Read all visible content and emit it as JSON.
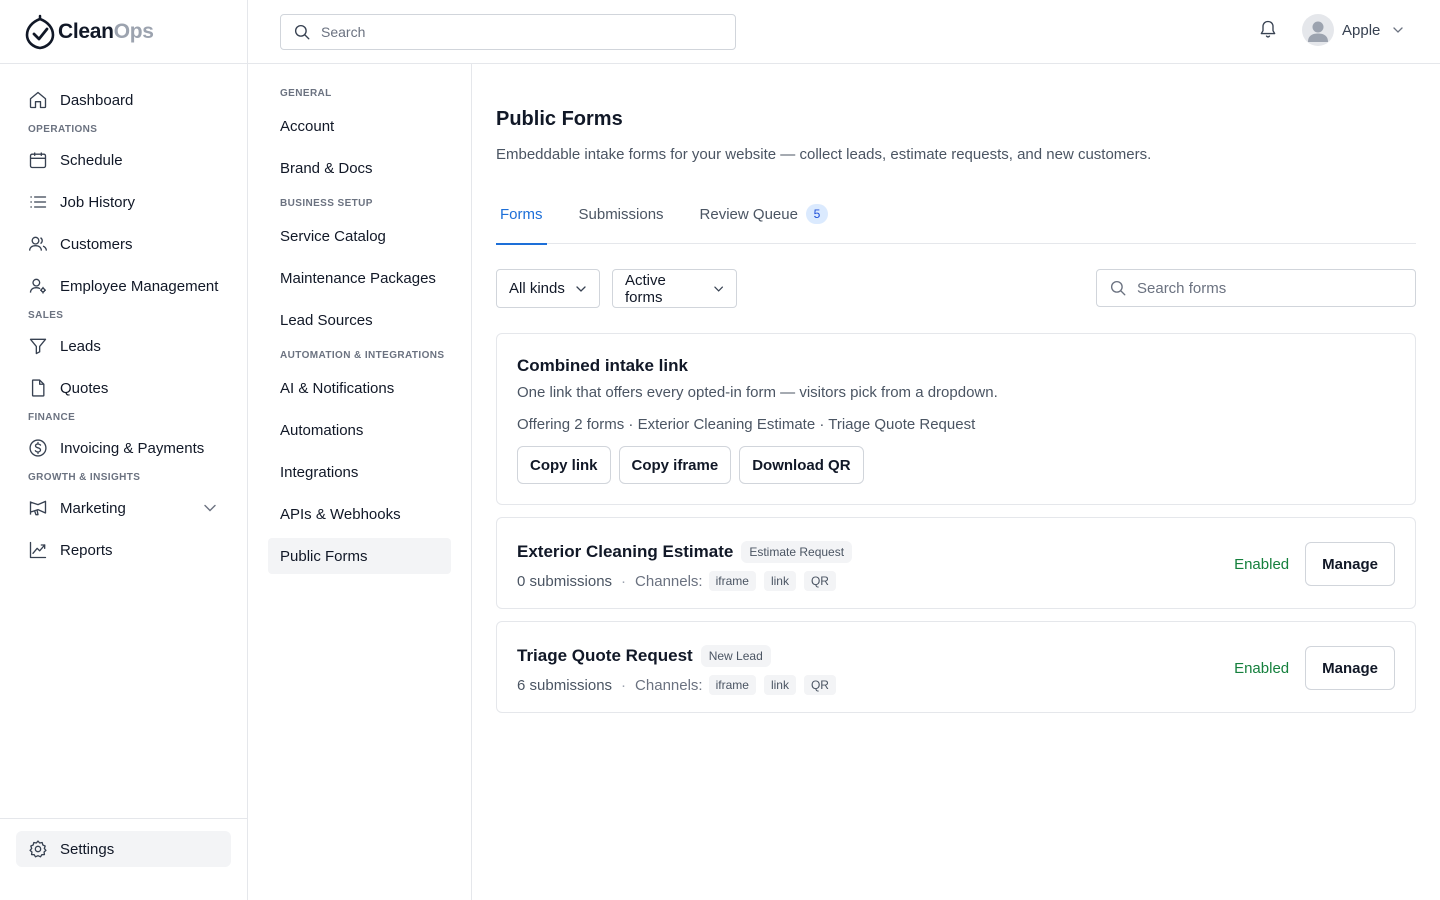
{
  "app": {
    "brand_a": "Clean",
    "brand_b": "Ops",
    "brand_color": "#111827"
  },
  "sidebar": {
    "items": [
      {
        "type": "item",
        "label": "Dashboard",
        "icon": "home-icon"
      },
      {
        "type": "section",
        "label": "OPERATIONS"
      },
      {
        "type": "item",
        "label": "Schedule",
        "icon": "calendar-icon"
      },
      {
        "type": "item",
        "label": "Job History",
        "icon": "list-icon"
      },
      {
        "type": "item",
        "label": "Customers",
        "icon": "users-icon"
      },
      {
        "type": "item",
        "label": "Employee Management",
        "icon": "user-cog-icon"
      },
      {
        "type": "section",
        "label": "SALES"
      },
      {
        "type": "item",
        "label": "Leads",
        "icon": "funnel-icon"
      },
      {
        "type": "item",
        "label": "Quotes",
        "icon": "document-icon"
      },
      {
        "type": "section",
        "label": "FINANCE"
      },
      {
        "type": "item",
        "label": "Invoicing & Payments",
        "icon": "dollar-circle-icon"
      },
      {
        "type": "section",
        "label": "GROWTH & INSIGHTS"
      },
      {
        "type": "item",
        "label": "Marketing",
        "icon": "megaphone-icon",
        "expandable": true
      },
      {
        "type": "item",
        "label": "Reports",
        "icon": "chart-line-icon"
      }
    ],
    "settings_label": "Settings"
  },
  "topbar": {
    "search_placeholder": "Search",
    "user_name": "Apple"
  },
  "subnav": {
    "groups": [
      {
        "section": "GENERAL",
        "items": [
          "Account",
          "Brand & Docs"
        ]
      },
      {
        "section": "BUSINESS SETUP",
        "items": [
          "Service Catalog",
          "Maintenance Packages",
          "Lead Sources"
        ]
      },
      {
        "section": "AUTOMATION & INTEGRATIONS",
        "items": [
          "AI & Notifications",
          "Automations",
          "Integrations",
          "APIs & Webhooks",
          "Public Forms"
        ]
      }
    ],
    "active": "Public Forms"
  },
  "main": {
    "title": "Public Forms",
    "description": "Embeddable intake forms for your website — collect leads, estimate requests, and new customers.",
    "tabs": [
      {
        "label": "Forms",
        "active": true
      },
      {
        "label": "Submissions",
        "active": false
      },
      {
        "label": "Review Queue",
        "active": false,
        "count": "5"
      }
    ],
    "filters": {
      "kind": "All kinds",
      "state": "Active forms",
      "search_placeholder": "Search forms"
    },
    "combined": {
      "title": "Combined intake link",
      "description": "One link that offers every opted-in form — visitors pick from a dropdown.",
      "offering": "Offering 2 forms · Exterior Cleaning Estimate · Triage Quote Request",
      "buttons": [
        "Copy link",
        "Copy iframe",
        "Download QR"
      ]
    },
    "forms": [
      {
        "title": "Exterior Cleaning Estimate",
        "kind": "Estimate Request",
        "submissions": "0 submissions",
        "channels_label": "Channels:",
        "channels": [
          "iframe",
          "link",
          "QR"
        ],
        "status": "Enabled",
        "action": "Manage"
      },
      {
        "title": "Triage Quote Request",
        "kind": "New Lead",
        "submissions": "6 submissions",
        "channels_label": "Channels:",
        "channels": [
          "iframe",
          "link",
          "QR"
        ],
        "status": "Enabled",
        "action": "Manage"
      }
    ],
    "accent_color": "#1d6fd8",
    "status_color": "#15803d"
  }
}
